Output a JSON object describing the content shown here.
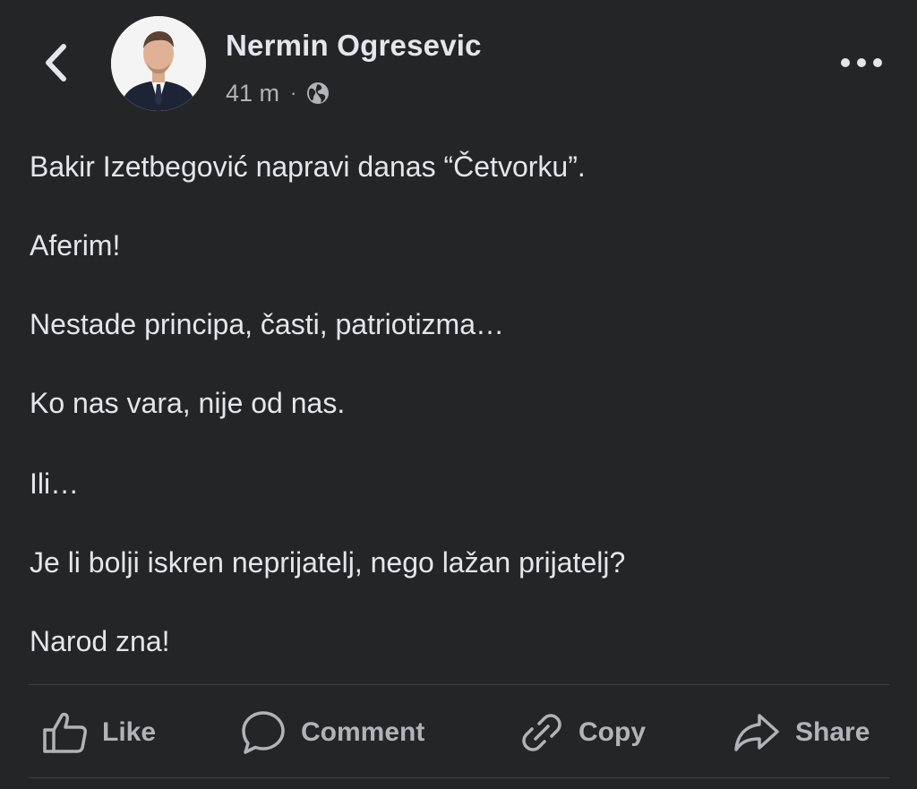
{
  "post": {
    "author": "Nermin Ogresevic",
    "time": "41 m",
    "separator": "·",
    "lines": [
      "Bakir Izetbegović napravi danas “Četvorku”.",
      "Aferim!",
      "Nestade principa, časti, patriotizma…",
      "Ko nas vara, nije od nas.",
      "Ili…",
      "Je li bolji iskren neprijatelj, nego lažan prijatelj?",
      "Narod zna!"
    ]
  },
  "actions": {
    "like": "Like",
    "comment": "Comment",
    "copy": "Copy",
    "share": "Share"
  },
  "icons": {
    "back": "chevron-left-icon",
    "more": "more-horizontal-icon",
    "audience": "globe-icon",
    "like": "thumbs-up-icon",
    "comment": "speech-bubble-icon",
    "copy": "link-icon",
    "share": "share-arrow-icon"
  },
  "colors": {
    "background": "#242526",
    "primary_text": "#e4e6eb",
    "secondary_text": "#b0b3b8",
    "divider": "#3e4042"
  }
}
